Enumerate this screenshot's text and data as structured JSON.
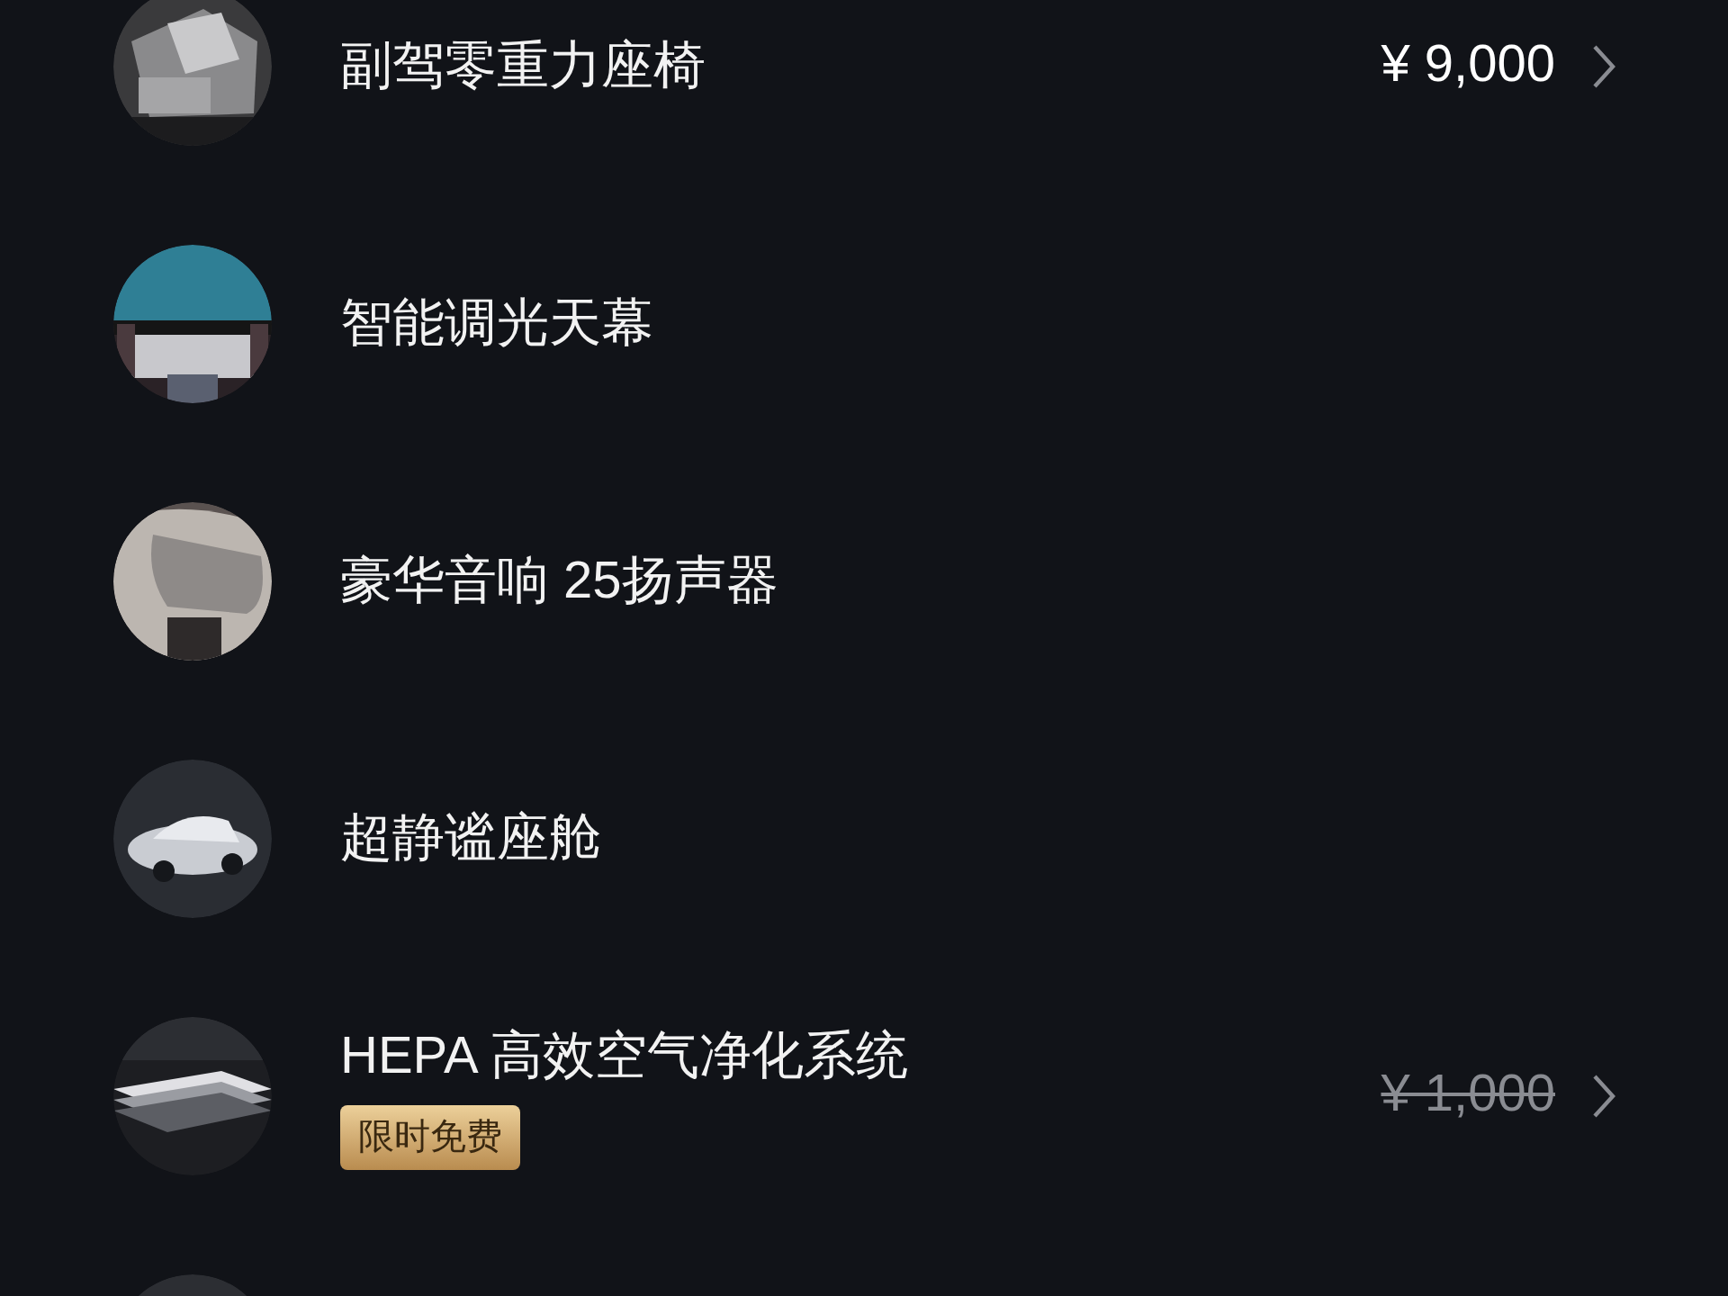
{
  "items": [
    {
      "kind": "picture",
      "title": "副驾零重力座椅",
      "price": "¥ 9,000",
      "struck": false
    },
    {
      "kind": "picture",
      "title": "智能调光天幕"
    },
    {
      "kind": "picture",
      "title": "豪华音响 25扬声器"
    },
    {
      "kind": "picture",
      "title": "超静谧座舱"
    },
    {
      "kind": "picture",
      "title": "HEPA 高效空气净化系统",
      "badge": "限时免费",
      "price": "¥ 1,000",
      "struck": true
    },
    {
      "kind": "picture"
    }
  ]
}
